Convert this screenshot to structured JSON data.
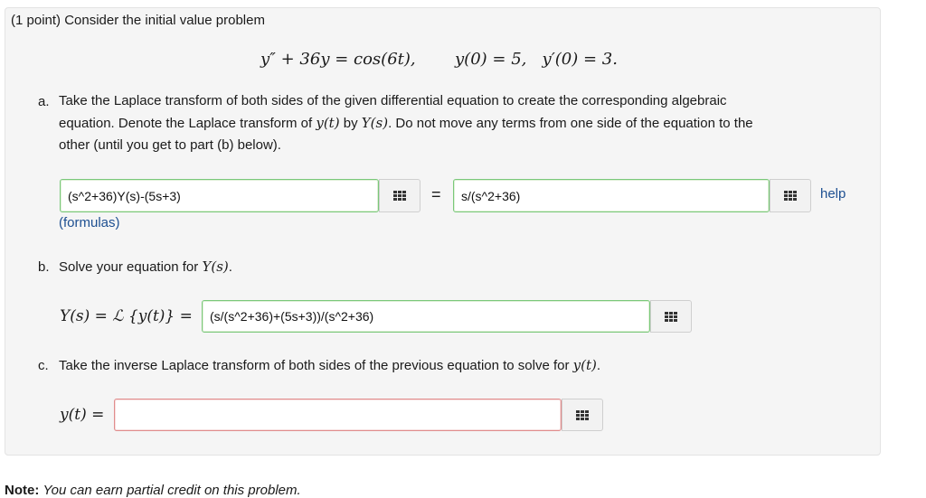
{
  "intro": "(1 point) Consider the initial value problem",
  "equation": {
    "ode": "y″ + 36y = cos(6t),",
    "initial_conditions": "y(0) = 5,   y′(0) = 3."
  },
  "part_a": {
    "label": "a.",
    "text_1": "Take the Laplace transform of both sides of the given differential equation to create the corresponding algebraic",
    "text_2_pre": "equation. Denote the Laplace transform of ",
    "text_2_yt": "y(t)",
    "text_2_mid": " by ",
    "text_2_Ys": "Y(s)",
    "text_2_post": ". Do not move any terms from one side of the equation to the",
    "text_3": "other (until you get to part (b) below).",
    "left_value": "(s^2+36)Y(s)-(5s+3)",
    "equals": "=",
    "right_value": "s/(s^2+36)",
    "formulas_link": "(formulas)",
    "help_link": "help"
  },
  "part_b": {
    "label": "b.",
    "text_pre": "Solve your equation for ",
    "text_Ys": "Y(s)",
    "text_post": ".",
    "lhs": "Y(s) = ℒ {y(t)} =",
    "value": "(s/(s^2+36)+(5s+3))/(s^2+36)"
  },
  "part_c": {
    "label": "c.",
    "text_pre": "Take the inverse Laplace transform of both sides of the previous equation to solve for ",
    "text_yt": "y(t)",
    "text_post": ".",
    "lhs": "y(t) =",
    "value": ""
  },
  "note": {
    "bold": "Note:",
    "italic": "You can earn partial credit on this problem."
  },
  "colors": {
    "correct_border": "#7ac87a",
    "incorrect_border": "#e08c8c",
    "link": "#1d4f91",
    "panel_bg": "#f5f5f5"
  },
  "icons": {
    "palette": "grid-icon"
  }
}
